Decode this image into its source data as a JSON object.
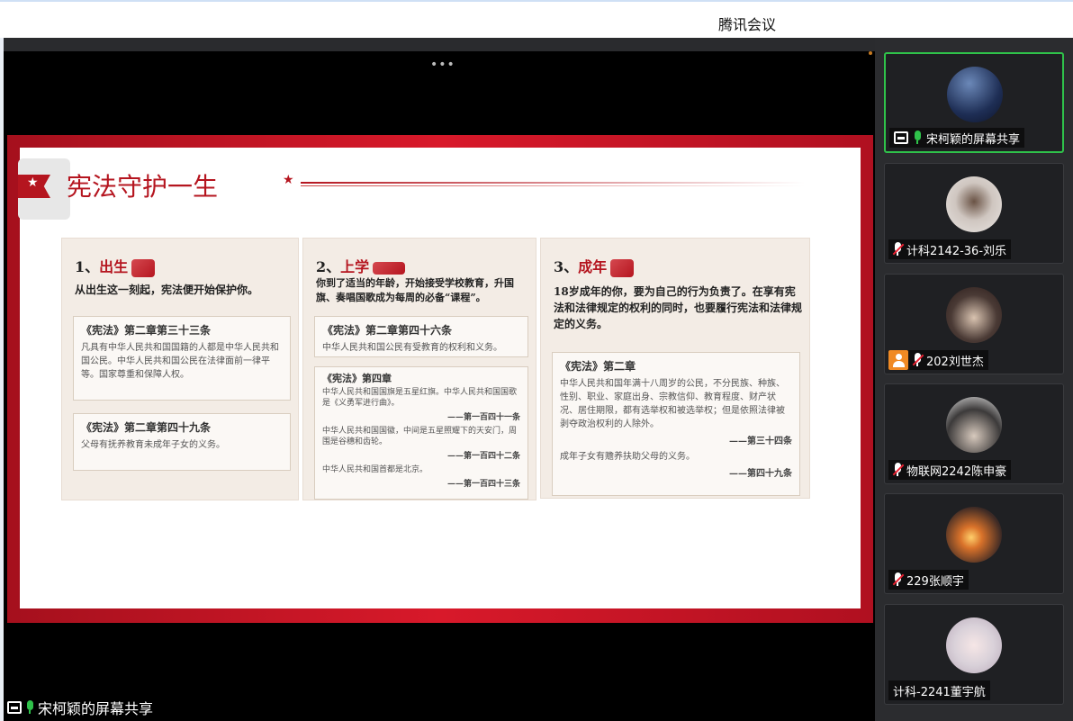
{
  "app": {
    "title": "腾讯会议"
  },
  "slide": {
    "title": "宪法守护一生",
    "columns": [
      {
        "heading_num": "1、",
        "heading": "出生",
        "intro": "从出生这一刻起，宪法便开始保护你。",
        "boxes": [
          {
            "title": "《宪法》第二章第三十三条",
            "body": "凡具有中华人民共和国国籍的人都是中华人民共和国公民。中华人民共和国公民在法律面前一律平等。国家尊重和保障人权。"
          },
          {
            "title": "《宪法》第二章第四十九条",
            "body": "父母有抚养教育未成年子女的义务。"
          }
        ]
      },
      {
        "heading_num": "2、",
        "heading": "上学",
        "intro": "你到了适当的年龄，开始接受学校教育，升国旗、奏唱国歌成为每周的必备“课程”。",
        "boxes": [
          {
            "title": "《宪法》第二章第四十六条",
            "body": "中华人民共和国公民有受教育的权利和义务。"
          },
          {
            "title": "《宪法》第四章",
            "body1": "中华人民共和国国旗是五星红旗。中华人民共和国国歌是《义勇军进行曲》。",
            "ref1": "——第一百四十一条",
            "body2": "中华人民共和国国徽，中间是五星照耀下的天安门，周围是谷穗和齿轮。",
            "ref2": "——第一百四十二条",
            "body3": "中华人民共和国首都是北京。",
            "ref3": "——第一百四十三条"
          }
        ]
      },
      {
        "heading_num": "3、",
        "heading": "成年",
        "intro": "18岁成年的你，要为自己的行为负责了。在享有宪法和法律规定的权利的同时，也要履行宪法和法律规定的义务。",
        "boxes": [
          {
            "title": "《宪法》第二章",
            "body1": "中华人民共和国年满十八周岁的公民，不分民族、种族、性别、职业、家庭出身、宗教信仰、教育程度、财产状况、居住期限，都有选举权和被选举权；但是依照法律被剥夺政治权利的人除外。",
            "ref1": "——第三十四条",
            "body2": "成年子女有赡养扶助父母的义务。",
            "ref2": "——第四十九条"
          }
        ]
      }
    ]
  },
  "share_label": "宋柯颖的屏幕共享",
  "participants": [
    {
      "name": "宋柯颖的屏幕共享",
      "avatar": "night-bridge-photo"
    },
    {
      "name": "计科2142-36-刘乐",
      "avatar": "hair-photo"
    },
    {
      "name": "202刘世杰",
      "avatar": "two-people-photo"
    },
    {
      "name": "物联网2242陈申豪",
      "avatar": "person-photo"
    },
    {
      "name": "229张顺宇",
      "avatar": "sunset-photo"
    },
    {
      "name": "计科-2241董宇航",
      "avatar": "anime-girl-photo"
    }
  ],
  "colors": {
    "accent_red": "#b5151f",
    "mic_green": "#2fc24a",
    "active_border": "#2fc24a",
    "sidebar_bg": "#2b2c2f"
  }
}
